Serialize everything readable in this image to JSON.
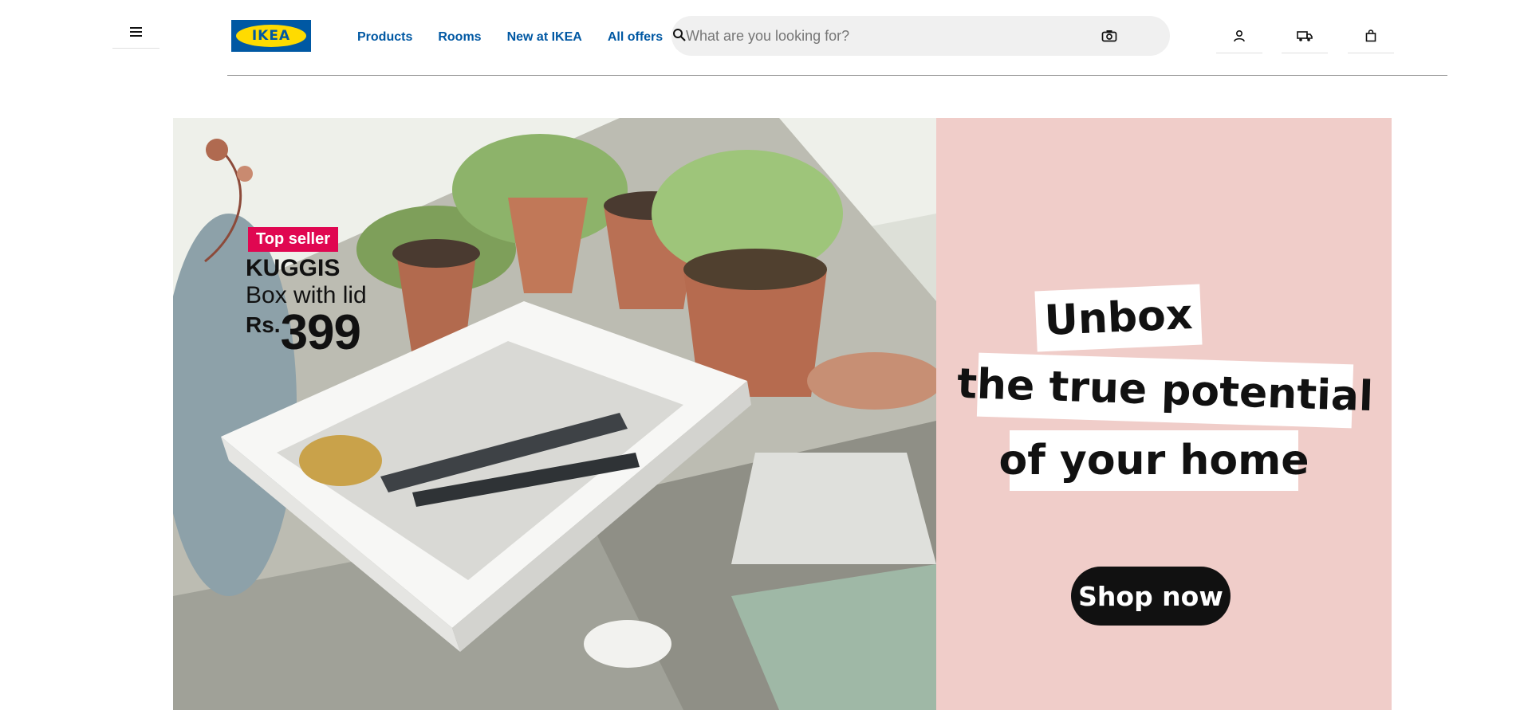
{
  "header": {
    "logo_text": "IKEA",
    "nav": [
      "Products",
      "Rooms",
      "New at IKEA",
      "All offers"
    ],
    "search": {
      "placeholder": "What are you looking for?"
    },
    "icons": [
      "hamburger-menu-icon",
      "search-icon",
      "camera-icon",
      "user-icon",
      "delivery-truck-icon",
      "shopping-bag-icon"
    ]
  },
  "hero": {
    "badge": "Top seller",
    "product_name": "KUGGIS",
    "product_desc": "Box with lid",
    "price_currency": "Rs.",
    "price_amount": "399",
    "headline": [
      "Unbox",
      "the true potential",
      "of your home"
    ],
    "cta": "Shop now"
  },
  "colors": {
    "brand_blue": "#0058a3",
    "brand_yellow": "#ffdb00",
    "badge_red": "#e00751",
    "promo_pink": "#f0cdc9"
  }
}
